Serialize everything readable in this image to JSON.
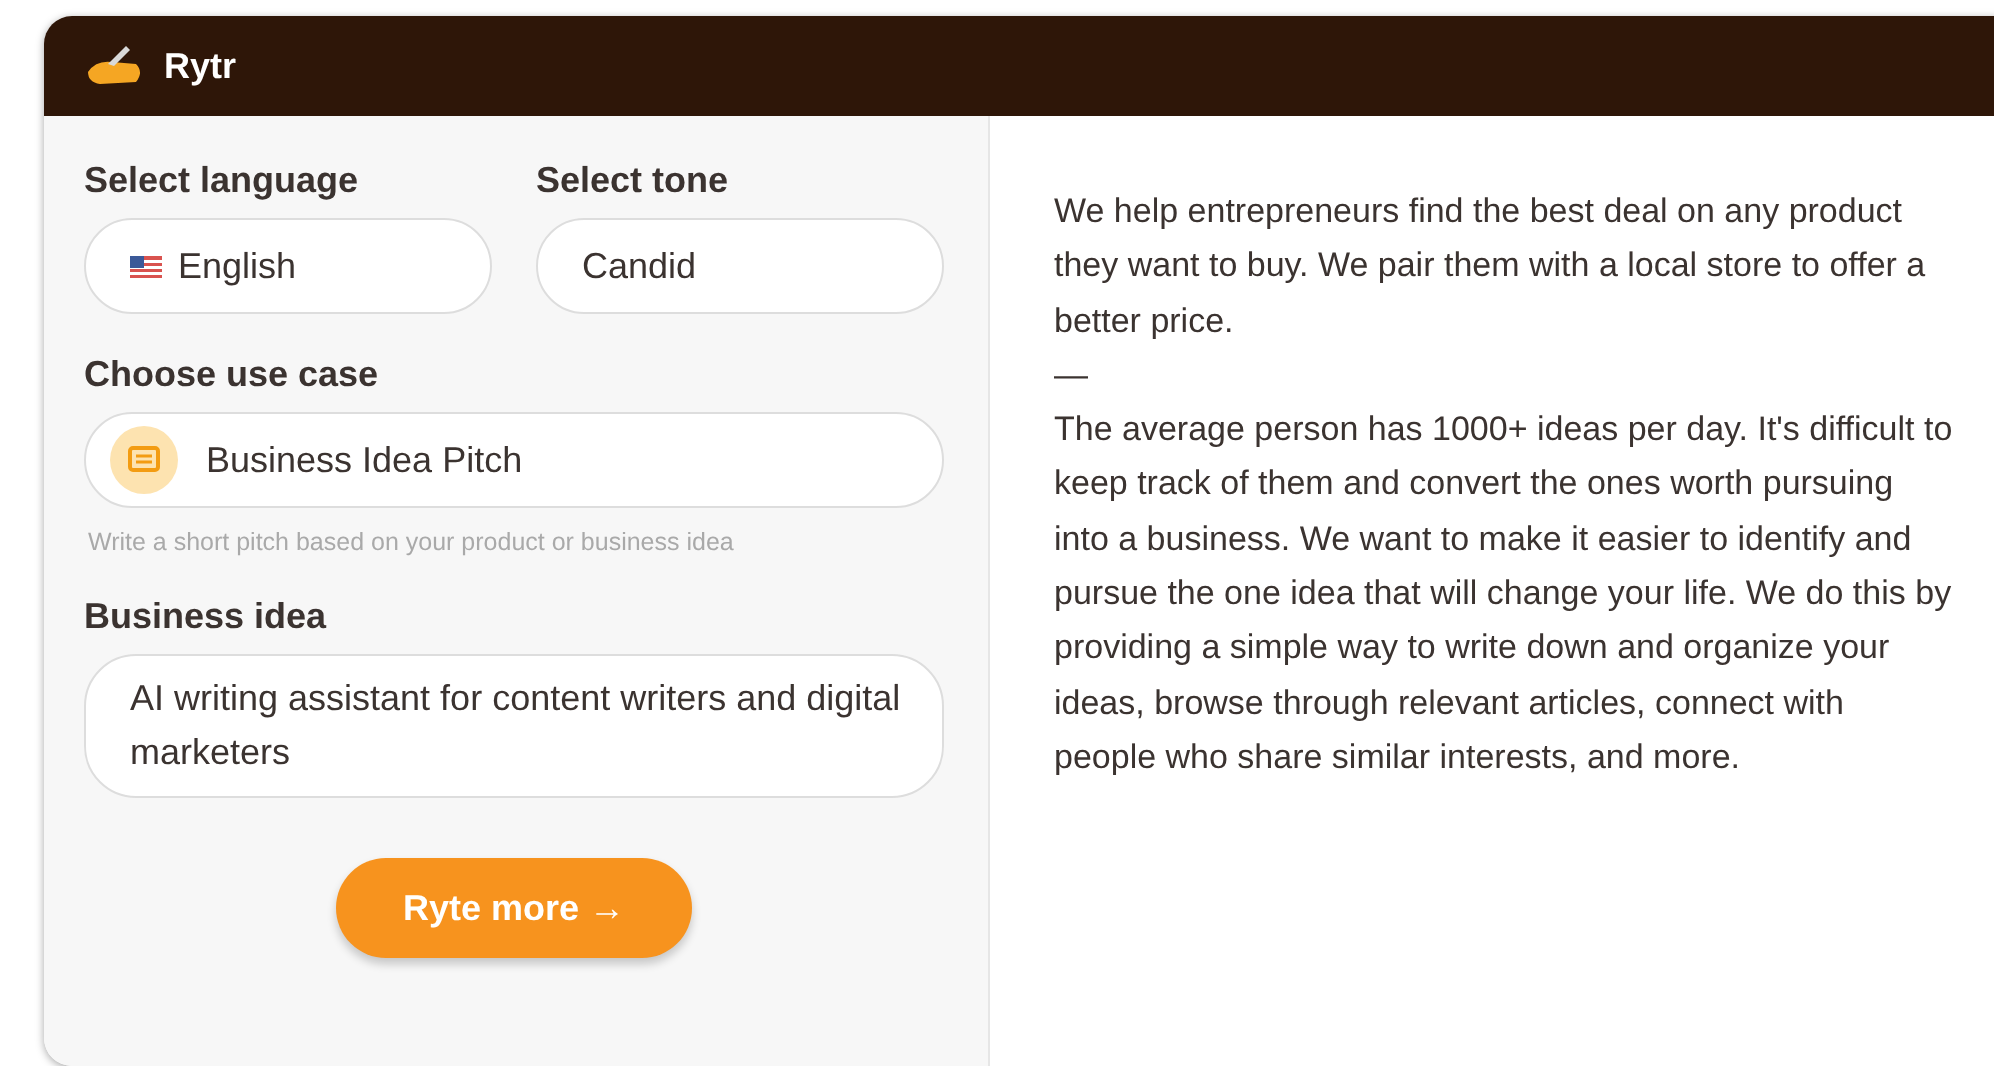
{
  "app": {
    "name": "Rytr"
  },
  "form": {
    "language": {
      "label": "Select language",
      "value": "English"
    },
    "tone": {
      "label": "Select tone",
      "value": "Candid"
    },
    "use_case": {
      "label": "Choose use case",
      "value": "Business Idea Pitch",
      "hint": "Write a short pitch based on your product or business idea"
    },
    "business_idea": {
      "label": "Business idea",
      "value": "AI writing assistant for content writers and digital marketers"
    },
    "button": "Ryte more →"
  },
  "output": [
    "We help entrepreneurs find the best deal on any product they want to buy. We pair them with a local store to offer a better price.",
    "—",
    "The average person has 1000+ ideas per day. It's difficult to keep track of them and convert the ones worth pursuing into a business. We want to make it easier to identify and pursue the one idea that will change your life. We do this by providing a simple way to write down and organize your ideas, browse through relevant articles, connect with people who share similar interests, and more."
  ]
}
